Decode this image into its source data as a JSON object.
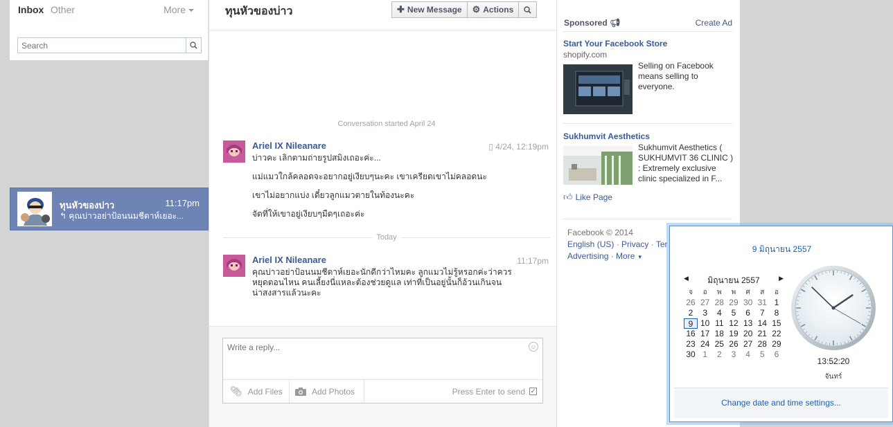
{
  "left": {
    "tabs": {
      "inbox": "Inbox",
      "other": "Other",
      "more": "More"
    },
    "search_placeholder": "Search",
    "thread": {
      "name": "ทุนหัวของบ่าว",
      "time": "11:17pm",
      "snippet": "↰ คุณบ่าวอย่าป้อนนมชีตาห์เยอะ..."
    }
  },
  "conversation": {
    "title": "ทุนหัวของบ่าว",
    "toolbar": {
      "new_message": "New Message",
      "actions": "Actions"
    },
    "started": "Conversation started April 24",
    "today_label": "Today",
    "messages": [
      {
        "sender": "Ariel IX Nileanare",
        "time": "4/24, 12:19pm",
        "lines": [
          "บ่าวคะ เลิกตามถ่ายรูปสมิงเถอะค่ะ...",
          "แม่แมวใกล้คลอดจะอยากอยู่เงียบๆนะคะ เขาเครียดเขาไม่คลอดนะ",
          "เขาไม่อยากแบ่ง เดี๋ยวลูกแมวตายในท้องนะคะ",
          "จัดที่ให้เขาอยู่เงียบๆมืดๆเถอะค่ะ"
        ]
      },
      {
        "sender": "Ariel IX Nileanare",
        "time": "11:17pm",
        "lines": [
          "คุณบ่าวอย่าป้อนนมชีตาห์เยอะนักดีกว่าไหมคะ ลูกแมวไม่รู้หรอกค่ะว่าควร",
          "หยุดตอนไหน คนเลี้ยงนี่แหละต้องช่วยดูแล เท่าที่เป็นอยู่นั้นก็อ้วนเกินจน",
          "น่าสงสารแล้วนะคะ"
        ]
      }
    ],
    "composer": {
      "placeholder": "Write a reply...",
      "add_files": "Add Files",
      "add_photos": "Add Photos",
      "press_enter": "Press Enter to send"
    }
  },
  "ads": {
    "sponsored": "Sponsored",
    "create_ad": "Create Ad",
    "items": [
      {
        "title": "Start Your Facebook Store",
        "domain": "shopify.com",
        "text": "Selling on Facebook means selling to everyone."
      },
      {
        "title": "Sukhumvit Aesthetics",
        "text": "Sukhumvit Aesthetics ( SUKHUMVIT 36 CLINIC ) : Extremely exclusive clinic specialized in F..."
      }
    ],
    "like_page": "Like Page",
    "footer": {
      "copyright": "Facebook © 2014",
      "english": "English (US)",
      "privacy": "Privacy",
      "terms": "Ter",
      "advertising": "Advertising",
      "more": "More"
    }
  },
  "calendar_popup": {
    "full_date": "9 มิถุนายน 2557",
    "month_label": "มิถุนายน 2557",
    "weekdays": [
      "จ",
      "อ",
      "พ",
      "พ",
      "ศ",
      "ส",
      "อ"
    ],
    "weeks": [
      [
        "26",
        "27",
        "28",
        "29",
        "30",
        "31",
        "1"
      ],
      [
        "2",
        "3",
        "4",
        "5",
        "6",
        "7",
        "8"
      ],
      [
        "9",
        "10",
        "11",
        "12",
        "13",
        "14",
        "15"
      ],
      [
        "16",
        "17",
        "18",
        "19",
        "20",
        "21",
        "22"
      ],
      [
        "23",
        "24",
        "25",
        "26",
        "27",
        "28",
        "29"
      ],
      [
        "30",
        "1",
        "2",
        "3",
        "4",
        "5",
        "6"
      ]
    ],
    "today": "9",
    "time": "13:52:20",
    "day_name": "จันทร์",
    "settings_link": "Change date and time settings..."
  },
  "colors": {
    "selected_thread": "#6d84b4",
    "link": "#3b5998",
    "windows_link": "#1a5fb4"
  }
}
